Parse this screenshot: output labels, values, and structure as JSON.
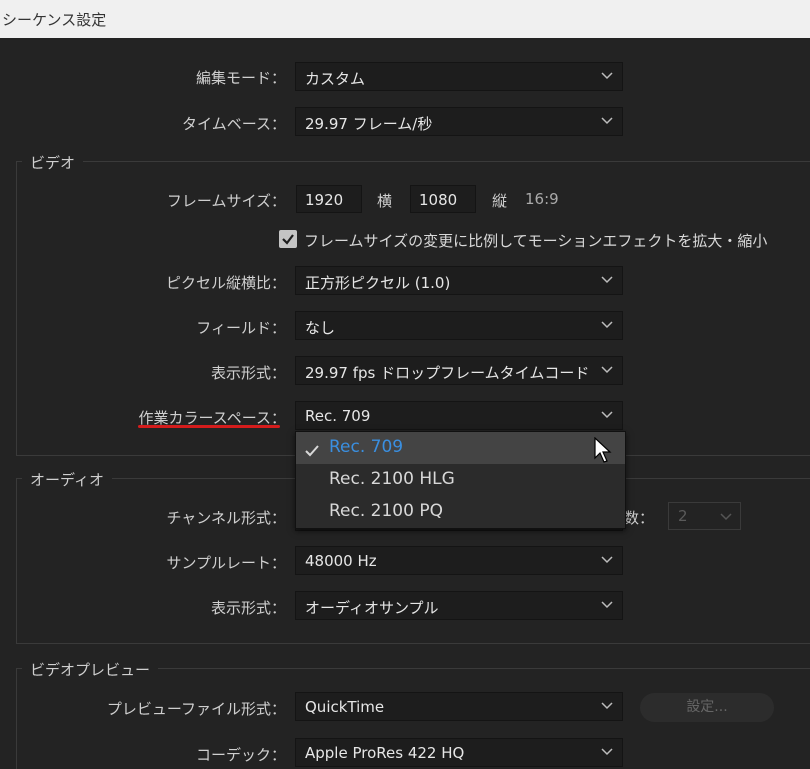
{
  "window": {
    "title": "シーケンス設定"
  },
  "top": {
    "edit_mode": {
      "label": "編集モード：",
      "value": "カスタム"
    },
    "timebase": {
      "label": "タイムベース：",
      "value": "29.97  フレーム/秒"
    }
  },
  "video": {
    "legend": "ビデオ",
    "frame_size": {
      "label": "フレームサイズ：",
      "width": "1920",
      "width_unit": "横",
      "height": "1080",
      "height_unit": "縦",
      "aspect": "16:9"
    },
    "scale_checkbox": {
      "checked": true,
      "label": "フレームサイズの変更に比例してモーションエフェクトを拡大・縮小"
    },
    "pixel_aspect": {
      "label": "ピクセル縦横比：",
      "value": "正方形ピクセル (1.0)"
    },
    "fields": {
      "label": "フィールド：",
      "value": "なし"
    },
    "display_format": {
      "label": "表示形式：",
      "value": "29.97  fps  ドロップフレームタイムコード"
    },
    "working_color_space": {
      "label": "作業カラースペース：",
      "value": "Rec. 709"
    }
  },
  "color_space_dropdown": {
    "options": [
      {
        "label": "Rec. 709",
        "selected": true
      },
      {
        "label": "Rec. 2100 HLG",
        "selected": false
      },
      {
        "label": "Rec. 2100 PQ",
        "selected": false
      }
    ]
  },
  "audio": {
    "legend": "オーディオ",
    "channel_format": {
      "label": "チャンネル形式："
    },
    "channel_count": {
      "label": "数：",
      "value": "2"
    },
    "sample_rate": {
      "label": "サンプルレート：",
      "value": "48000 Hz"
    },
    "display_format": {
      "label": "表示形式：",
      "value": "オーディオサンプル"
    }
  },
  "video_preview": {
    "legend": "ビデオプレビュー",
    "file_format": {
      "label": "プレビューファイル形式：",
      "value": "QuickTime"
    },
    "settings_button": "設定...",
    "codec": {
      "label": "コーデック：",
      "value": "Apple ProRes 422 HQ"
    }
  },
  "colors": {
    "accent_selected": "#3a8fe0",
    "annotation_underline": "#d41c1c",
    "background": "#232323"
  }
}
